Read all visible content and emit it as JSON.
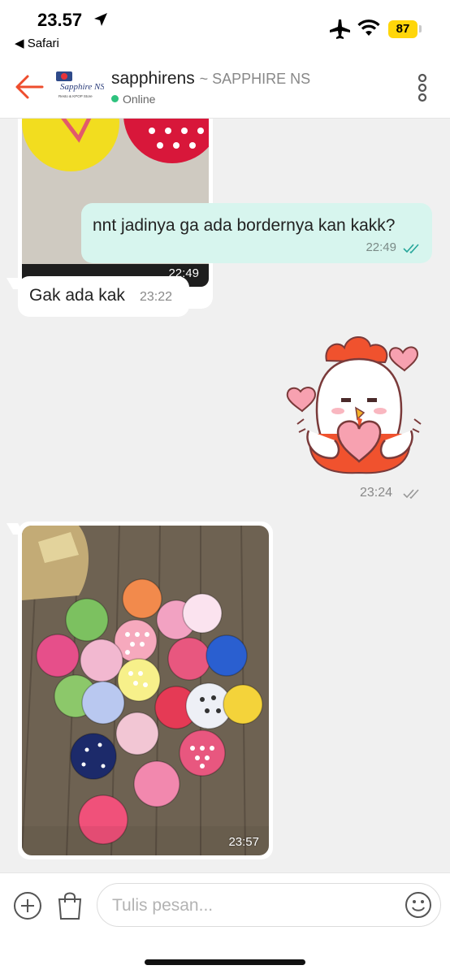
{
  "status_bar": {
    "time": "23.57",
    "back_app": "◀ Safari",
    "battery": "87"
  },
  "header": {
    "name": "sapphirens",
    "subname": "~ SAPPHIRE NS",
    "status": "Online",
    "avatar_logo_text": "Sapphire NS",
    "avatar_sub_text": "Resto & KPOP Store"
  },
  "messages": [
    {
      "type": "image",
      "direction": "in",
      "time": "22:49"
    },
    {
      "type": "text",
      "direction": "out",
      "text": "nnt jadinya ga ada bordernya kan kakk?",
      "time": "22:49",
      "read": true
    },
    {
      "type": "text",
      "direction": "in",
      "text": "Gak ada kak",
      "time": "23:22"
    },
    {
      "type": "sticker",
      "direction": "out",
      "time": "23:24",
      "read": false,
      "icon": "chicken-holding-heart-sticker"
    },
    {
      "type": "image",
      "direction": "in",
      "time": "23:57"
    }
  ],
  "composer": {
    "placeholder": "Tulis pesan...",
    "value": ""
  },
  "colors": {
    "accent": "#ee4d2d",
    "outgoing_bubble": "#d7f5ee",
    "online_dot": "#2ec27e",
    "battery": "#ffd60a"
  }
}
